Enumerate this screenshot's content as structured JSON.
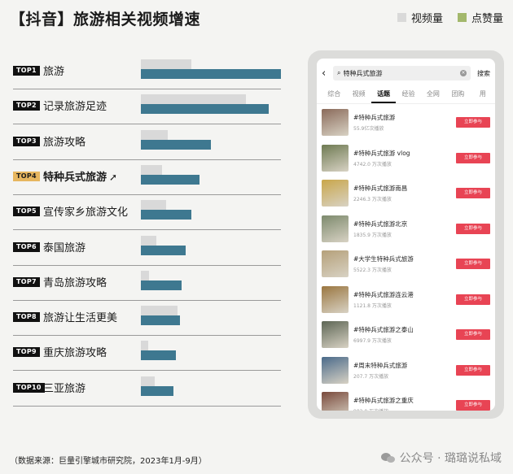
{
  "title": "【抖音】旅游相关视频增速",
  "legend": {
    "video": {
      "label": "视频量",
      "color": "#d9d9d9"
    },
    "likes": {
      "label": "点赞量",
      "color": "#a3b86c"
    }
  },
  "source": "（数据来源：巨量引擎城市研究院，2023年1月-9月）",
  "watermark": "公众号 · 璐璐说私域",
  "chart_data": {
    "type": "bar",
    "orientation": "horizontal",
    "categories": [
      "旅游",
      "记录旅游足迹",
      "旅游攻略",
      "特种兵式旅游",
      "宣传家乡旅游文化",
      "泰国旅游",
      "青岛旅游攻略",
      "旅游让生活更美",
      "重庆旅游攻略",
      "三亚旅游"
    ],
    "ranks": [
      "TOP1",
      "TOP2",
      "TOP3",
      "TOP4",
      "TOP5",
      "TOP6",
      "TOP7",
      "TOP8",
      "TOP9",
      "TOP10"
    ],
    "highlight_index": 3,
    "highlight_arrow": "➚",
    "series": [
      {
        "name": "视频量",
        "color": "#d9d9d9",
        "values": [
          36,
          75,
          19,
          15,
          18,
          11,
          6,
          26,
          5,
          10
        ]
      },
      {
        "name": "点赞量",
        "color": "#3e7890",
        "values": [
          100,
          91,
          50,
          42,
          36,
          32,
          29,
          28,
          25,
          23
        ]
      }
    ],
    "xlim": [
      0,
      100
    ]
  },
  "phone": {
    "search_query": "特种兵式旅游",
    "search_button": "搜索",
    "back_icon": "‹",
    "search_icon": "⌕",
    "clear_icon": "×",
    "tabs": [
      "综合",
      "视频",
      "话题",
      "经验",
      "全网",
      "团购",
      "用"
    ],
    "active_tab": 2,
    "join_label": "立即参与",
    "results": [
      {
        "title": "#特种兵式旅游",
        "plays": "55.9亿次播放",
        "thumb_color": "#8a6a5a"
      },
      {
        "title": "#特种兵式旅游 vlog",
        "plays": "4742.0 万次播放",
        "thumb_color": "#6e7a52"
      },
      {
        "title": "#特种兵式旅游南昌",
        "plays": "2246.3 万次播放",
        "thumb_color": "#c9a64a"
      },
      {
        "title": "#特种兵式旅游北京",
        "plays": "1835.9 万次播放",
        "thumb_color": "#7d8a6d"
      },
      {
        "title": "#大学生特种兵式旅游",
        "plays": "5522.3 万次播放",
        "thumb_color": "#b5a079"
      },
      {
        "title": "#特种兵式旅游连云港",
        "plays": "1121.8 万次播放",
        "thumb_color": "#9a7640"
      },
      {
        "title": "#特种兵式旅游之泰山",
        "plays": "6997.9 万次播放",
        "thumb_color": "#5d6655"
      },
      {
        "title": "#周末特种兵式旅游",
        "plays": "207.7 万次播放",
        "thumb_color": "#4a6a8a"
      },
      {
        "title": "#特种兵式旅游之重庆",
        "plays": "982.0 万次播放",
        "thumb_color": "#7a4a3c"
      }
    ]
  }
}
